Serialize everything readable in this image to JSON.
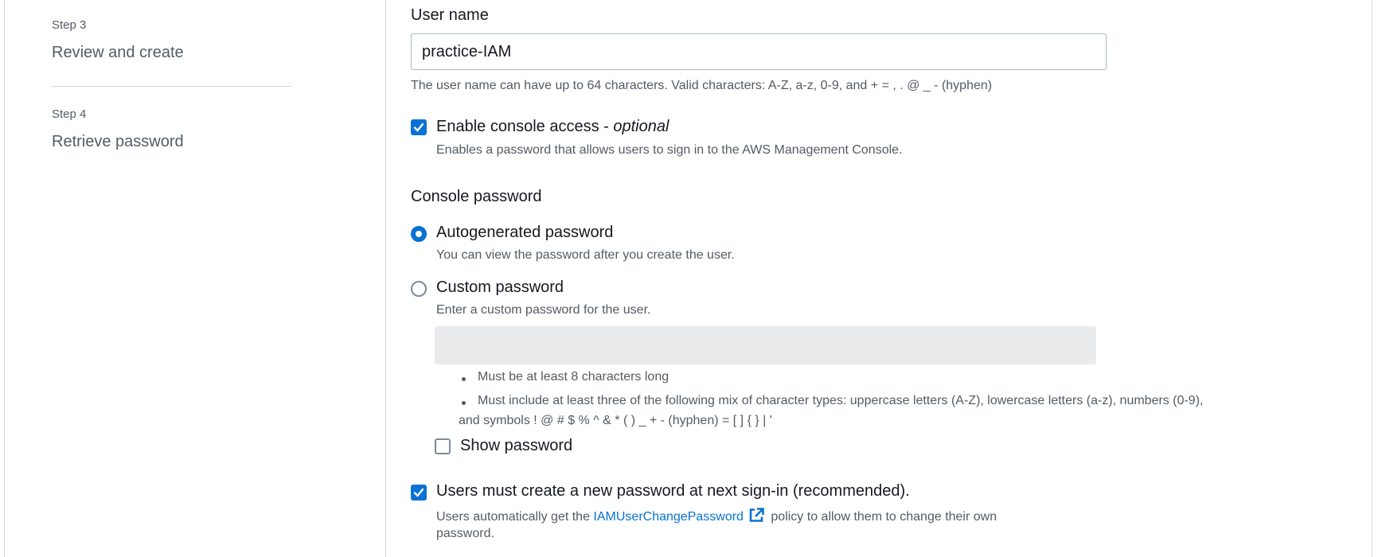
{
  "steps": [
    {
      "label": "Step 3",
      "title": "Review and create"
    },
    {
      "label": "Step 4",
      "title": "Retrieve password"
    }
  ],
  "user_name": {
    "label": "User name",
    "value": "practice-IAM",
    "help": "The user name can have up to 64 characters. Valid characters: A-Z, a-z, 0-9, and + = , . @ _ - (hyphen)"
  },
  "console_access": {
    "checked": true,
    "label": "Enable console access - ",
    "label_suffix": "optional",
    "description": "Enables a password that allows users to sign in to the AWS Management Console."
  },
  "console_password": {
    "heading": "Console password",
    "options": [
      {
        "label": "Autogenerated password",
        "description": "You can view the password after you create the user.",
        "selected": true
      },
      {
        "label": "Custom password",
        "description": "Enter a custom password for the user.",
        "selected": false
      }
    ],
    "custom_value": "",
    "requirements": [
      "Must be at least 8 characters long",
      "Must include at least three of the following mix of character types: uppercase letters (A-Z), lowercase letters (a-z), numbers (0-9),",
      "and symbols ! @ # $ % ^ & * ( ) _ + - (hyphen) = [ ] { } | '"
    ],
    "show_password_label": "Show password",
    "show_password_checked": false
  },
  "reset_required": {
    "checked": true,
    "label": "Users must create a new password at next sign-in (recommended).",
    "desc_prefix": "Users automatically get the ",
    "policy_link": "IAMUserChangePassword",
    "desc_suffix": " policy to allow them to change their own",
    "desc_line2": "password."
  },
  "colors": {
    "accent": "#0972d3",
    "text": "#16191f",
    "muted": "#545b64"
  },
  "icons": {
    "external_link": "external-link-icon",
    "check": "check-icon"
  }
}
